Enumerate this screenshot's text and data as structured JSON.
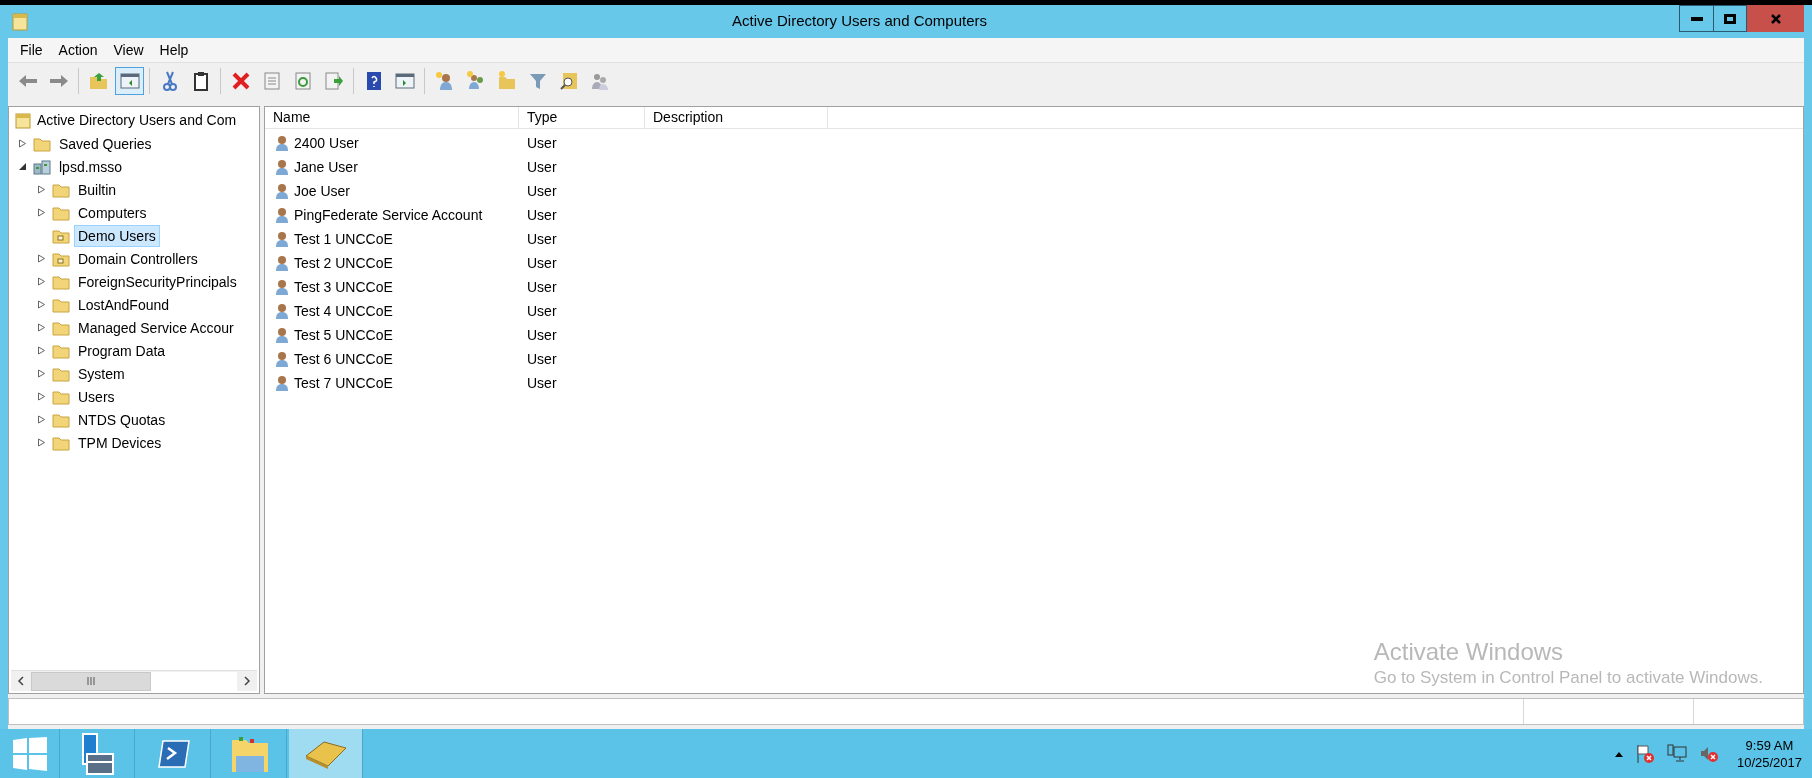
{
  "window": {
    "title": "Active Directory Users and Computers"
  },
  "menu": [
    "File",
    "Action",
    "View",
    "Help"
  ],
  "toolbar": [
    {
      "pressed": false
    },
    {
      "pressed": false
    },
    {
      "pressed": false
    },
    {
      "pressed": true
    },
    {
      "pressed": false
    },
    {
      "pressed": false
    },
    {
      "pressed": false
    },
    {
      "pressed": false
    },
    {
      "pressed": false
    },
    {
      "pressed": false
    },
    {
      "pressed": false
    },
    {
      "pressed": false
    },
    {
      "pressed": false
    },
    {
      "pressed": false
    },
    {
      "pressed": false
    },
    {
      "pressed": false
    },
    {
      "pressed": false
    },
    {
      "pressed": false
    }
  ],
  "tree": {
    "label": "Active Directory Users and Com",
    "kind": "root",
    "selected": false,
    "children": [
      {
        "label": "Saved Queries",
        "kind": "folder",
        "expanded": false,
        "selected": false
      },
      {
        "label": "lpsd.msso",
        "kind": "domain",
        "expanded": true,
        "selected": false,
        "children": [
          {
            "label": "Builtin",
            "kind": "folder",
            "expanded": false,
            "selected": false
          },
          {
            "label": "Computers",
            "kind": "folder",
            "expanded": false,
            "selected": false
          },
          {
            "label": "Demo Users",
            "kind": "ou",
            "selected": true
          },
          {
            "label": "Domain Controllers",
            "kind": "ou",
            "expanded": false,
            "selected": false
          },
          {
            "label": "ForeignSecurityPrincipals",
            "kind": "folder",
            "expanded": false,
            "selected": false
          },
          {
            "label": "LostAndFound",
            "kind": "folder",
            "expanded": false,
            "selected": false
          },
          {
            "label": "Managed Service Accour",
            "kind": "folder",
            "expanded": false,
            "selected": false
          },
          {
            "label": "Program Data",
            "kind": "folder",
            "expanded": false,
            "selected": false
          },
          {
            "label": "System",
            "kind": "folder",
            "expanded": false,
            "selected": false
          },
          {
            "label": "Users",
            "kind": "folder",
            "expanded": false,
            "selected": false
          },
          {
            "label": "NTDS Quotas",
            "kind": "folder",
            "expanded": false,
            "selected": false
          },
          {
            "label": "TPM Devices",
            "kind": "folder",
            "expanded": false,
            "selected": false
          }
        ]
      }
    ]
  },
  "table": {
    "columns": [
      "Name",
      "Type",
      "Description"
    ],
    "rows": [
      {
        "name": "2400 User",
        "type": "User"
      },
      {
        "name": "Jane User",
        "type": "User"
      },
      {
        "name": "Joe User",
        "type": "User"
      },
      {
        "name": "PingFederate Service Account",
        "type": "User"
      },
      {
        "name": "Test 1 UNCCoE",
        "type": "User"
      },
      {
        "name": "Test 2 UNCCoE",
        "type": "User"
      },
      {
        "name": "Test 3 UNCCoE",
        "type": "User"
      },
      {
        "name": "Test 4 UNCCoE",
        "type": "User"
      },
      {
        "name": "Test 5 UNCCoE",
        "type": "User"
      },
      {
        "name": "Test 6 UNCCoE",
        "type": "User"
      },
      {
        "name": "Test 7 UNCCoE",
        "type": "User"
      }
    ]
  },
  "activation_notice": {
    "title": "Activate Windows",
    "message": "Go to System in Control Panel to activate Windows."
  },
  "taskbar": {
    "apps": [
      {
        "active": false
      },
      {
        "active": false
      },
      {
        "active": false
      },
      {
        "active": true
      }
    ],
    "time": "9:59 AM",
    "date": "10/25/2017"
  }
}
